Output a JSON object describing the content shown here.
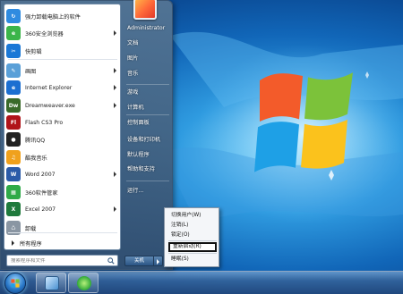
{
  "colors": {
    "accent": "#2a78c8",
    "menu_bg": "#3f6388",
    "highlight_border": "#111111"
  },
  "start_menu": {
    "pinned": [
      {
        "label": "强力卸载电脑上的软件",
        "icon": "uninstaller-icon",
        "color": "#2f8be0",
        "glyph": "↻",
        "has_arrow": false
      },
      {
        "label": "360安全浏览器",
        "icon": "360-browser-icon",
        "color": "#3bb54a",
        "glyph": "e",
        "has_arrow": true
      },
      {
        "label": "快剪辑",
        "icon": "kuaijianji-icon",
        "color": "#1a78d6",
        "glyph": "✂",
        "has_arrow": false
      },
      {
        "label": "画图",
        "icon": "paint-icon",
        "color": "#5aa0d8",
        "glyph": "✎",
        "has_arrow": true
      },
      {
        "label": "Internet Explorer",
        "icon": "internet-explorer-icon",
        "color": "#1c6fd1",
        "glyph": "e",
        "has_arrow": true
      },
      {
        "label": "Dreamweaver.exe",
        "icon": "dreamweaver-icon",
        "color": "#3a6a2a",
        "glyph": "Dw",
        "has_arrow": true
      },
      {
        "label": "Flash CS3 Pro",
        "icon": "flash-icon",
        "color": "#b0141a",
        "glyph": "Fl",
        "has_arrow": false
      },
      {
        "label": "腾讯QQ",
        "icon": "qq-icon",
        "color": "#222222",
        "glyph": "●",
        "has_arrow": false
      },
      {
        "label": "酷我音乐",
        "icon": "kuwo-music-icon",
        "color": "#f0a11c",
        "glyph": "♫",
        "has_arrow": false
      },
      {
        "label": "Word 2007",
        "icon": "word-icon",
        "color": "#2b5ba8",
        "glyph": "W",
        "has_arrow": true
      },
      {
        "label": "360软件管家",
        "icon": "360-software-manager-icon",
        "color": "#2faa48",
        "glyph": "▦",
        "has_arrow": false
      },
      {
        "label": "Excel 2007",
        "icon": "excel-icon",
        "color": "#1f7a3c",
        "glyph": "X",
        "has_arrow": true
      },
      {
        "label": "卸载",
        "icon": "recycle-bin-icon",
        "color": "#8a96a3",
        "glyph": "♺",
        "has_arrow": false
      }
    ],
    "all_programs": "所有程序",
    "search_placeholder": "搜索程序和文件"
  },
  "right_pane": {
    "items": [
      {
        "label": "Administrator",
        "name": "right-item-administrator"
      },
      {
        "label": "文档",
        "name": "right-item-documents"
      },
      {
        "label": "图片",
        "name": "right-item-pictures"
      },
      {
        "label": "音乐",
        "name": "right-item-music"
      },
      {
        "label": "游戏",
        "name": "right-item-games"
      },
      {
        "label": "计算机",
        "name": "right-item-computer"
      },
      {
        "label": "控制面板",
        "name": "right-item-control-panel"
      },
      {
        "label": "设备和打印机",
        "name": "right-item-devices-printers"
      },
      {
        "label": "默认程序",
        "name": "right-item-default-programs"
      },
      {
        "label": "帮助和支持",
        "name": "right-item-help-support"
      },
      {
        "label": "运行...",
        "name": "right-item-run"
      }
    ],
    "shutdown_label": "关机"
  },
  "shutdown_menu": {
    "items": [
      {
        "label": "切换用户(W)",
        "name": "switch-user-item",
        "highlight": false
      },
      {
        "label": "注销(L)",
        "name": "log-off-item",
        "highlight": false
      },
      {
        "label": "锁定(O)",
        "name": "lock-item",
        "highlight": false
      },
      {
        "label": "重新启动(R)",
        "name": "restart-item",
        "highlight": true
      },
      {
        "label": "睡眠(S)",
        "name": "sleep-item",
        "highlight": false
      }
    ]
  }
}
